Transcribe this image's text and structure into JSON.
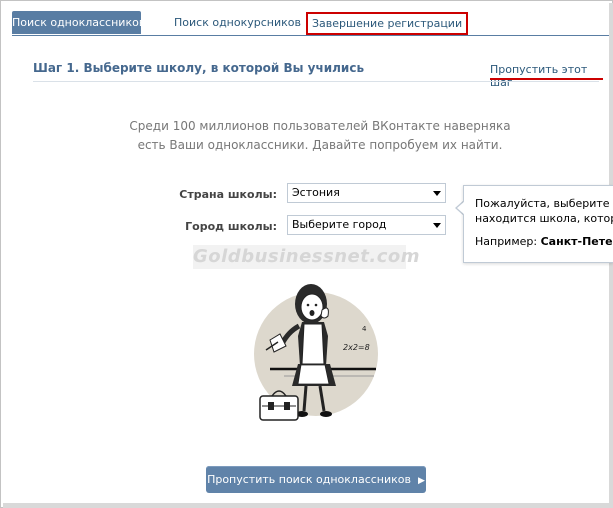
{
  "tabs": [
    {
      "label": "Поиск одноклассников",
      "active": true
    },
    {
      "label": "Поиск однокурсников",
      "active": false
    },
    {
      "label": "Завершение регистрации",
      "active": false,
      "highlighted": true
    }
  ],
  "step": {
    "title": "Шаг 1. Выберите школу, в которой Вы учились",
    "skip_link": "Пропустить этот шаг"
  },
  "intro": {
    "line1": "Среди 100 миллионов пользователей ВКонтакте наверняка",
    "line2": "есть Ваши одноклассники. Давайте попробуем их найти."
  },
  "form": {
    "country_label": "Страна школы:",
    "country_value": "Эстония",
    "city_label": "Город школы:",
    "city_value": "Выберите город"
  },
  "tooltip": {
    "line1": "Пожалуйста, выберите гор",
    "line2": "находится школа, которун",
    "example_prefix": "Например: ",
    "example_value": "Санкт-Петер("
  },
  "watermark": "Goldbusinessnet.com",
  "skip_search_button": "Пропустить поиск одноклассников",
  "colors": {
    "accent": "#597da3",
    "link": "#2b587a",
    "highlight_border": "#cc0000",
    "button": "#6083a9"
  }
}
